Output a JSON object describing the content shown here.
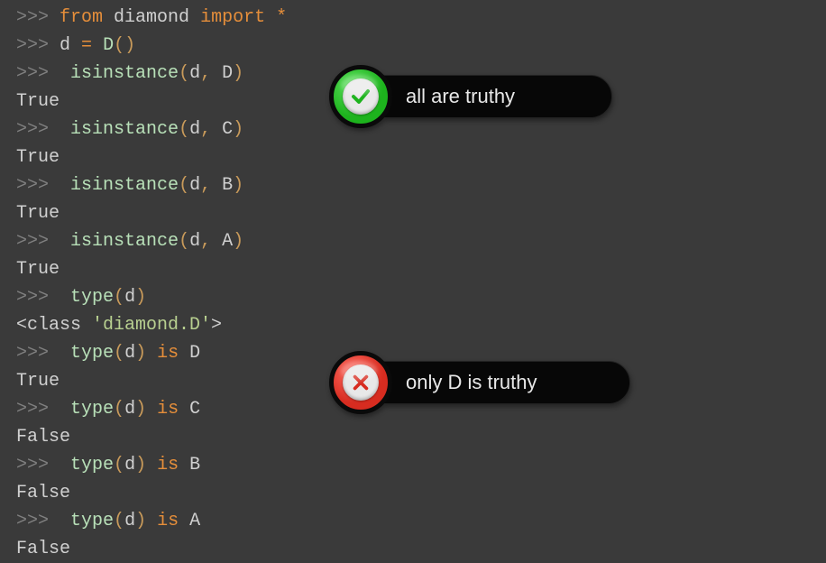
{
  "code_lines": [
    {
      "segments": [
        {
          "cls": "prompt",
          "t": ">>> "
        },
        {
          "cls": "kw",
          "t": "from"
        },
        {
          "cls": "txt",
          "t": " diamond "
        },
        {
          "cls": "kw",
          "t": "import"
        },
        {
          "cls": "txt",
          "t": " "
        },
        {
          "cls": "op",
          "t": "*"
        }
      ]
    },
    {
      "segments": [
        {
          "cls": "prompt",
          "t": ">>> "
        },
        {
          "cls": "txt",
          "t": "d "
        },
        {
          "cls": "op",
          "t": "="
        },
        {
          "cls": "txt",
          "t": " "
        },
        {
          "cls": "fn",
          "t": "D"
        },
        {
          "cls": "pn",
          "t": "()"
        }
      ]
    },
    {
      "segments": [
        {
          "cls": "prompt",
          "t": ">>> "
        },
        {
          "cls": "txt",
          "t": " "
        },
        {
          "cls": "fn",
          "t": "isinstance"
        },
        {
          "cls": "pn",
          "t": "("
        },
        {
          "cls": "txt",
          "t": "d"
        },
        {
          "cls": "cm",
          "t": ", "
        },
        {
          "cls": "txt",
          "t": "D"
        },
        {
          "cls": "pn",
          "t": ")"
        }
      ]
    },
    {
      "segments": [
        {
          "cls": "out",
          "t": "True"
        }
      ]
    },
    {
      "segments": [
        {
          "cls": "prompt",
          "t": ">>> "
        },
        {
          "cls": "txt",
          "t": " "
        },
        {
          "cls": "fn",
          "t": "isinstance"
        },
        {
          "cls": "pn",
          "t": "("
        },
        {
          "cls": "txt",
          "t": "d"
        },
        {
          "cls": "cm",
          "t": ", "
        },
        {
          "cls": "txt",
          "t": "C"
        },
        {
          "cls": "pn",
          "t": ")"
        }
      ]
    },
    {
      "segments": [
        {
          "cls": "out",
          "t": "True"
        }
      ]
    },
    {
      "segments": [
        {
          "cls": "prompt",
          "t": ">>> "
        },
        {
          "cls": "txt",
          "t": " "
        },
        {
          "cls": "fn",
          "t": "isinstance"
        },
        {
          "cls": "pn",
          "t": "("
        },
        {
          "cls": "txt",
          "t": "d"
        },
        {
          "cls": "cm",
          "t": ", "
        },
        {
          "cls": "txt",
          "t": "B"
        },
        {
          "cls": "pn",
          "t": ")"
        }
      ]
    },
    {
      "segments": [
        {
          "cls": "out",
          "t": "True"
        }
      ]
    },
    {
      "segments": [
        {
          "cls": "prompt",
          "t": ">>> "
        },
        {
          "cls": "txt",
          "t": " "
        },
        {
          "cls": "fn",
          "t": "isinstance"
        },
        {
          "cls": "pn",
          "t": "("
        },
        {
          "cls": "txt",
          "t": "d"
        },
        {
          "cls": "cm",
          "t": ", "
        },
        {
          "cls": "txt",
          "t": "A"
        },
        {
          "cls": "pn",
          "t": ")"
        }
      ]
    },
    {
      "segments": [
        {
          "cls": "out",
          "t": "True"
        }
      ]
    },
    {
      "segments": [
        {
          "cls": "prompt",
          "t": ">>> "
        },
        {
          "cls": "txt",
          "t": " "
        },
        {
          "cls": "fn",
          "t": "type"
        },
        {
          "cls": "pn",
          "t": "("
        },
        {
          "cls": "txt",
          "t": "d"
        },
        {
          "cls": "pn",
          "t": ")"
        }
      ]
    },
    {
      "segments": [
        {
          "cls": "out",
          "t": "<class "
        },
        {
          "cls": "str",
          "t": "'diamond.D'"
        },
        {
          "cls": "out",
          "t": ">"
        }
      ]
    },
    {
      "segments": [
        {
          "cls": "prompt",
          "t": ">>> "
        },
        {
          "cls": "txt",
          "t": " "
        },
        {
          "cls": "fn",
          "t": "type"
        },
        {
          "cls": "pn",
          "t": "("
        },
        {
          "cls": "txt",
          "t": "d"
        },
        {
          "cls": "pn",
          "t": ")"
        },
        {
          "cls": "txt",
          "t": " "
        },
        {
          "cls": "kw",
          "t": "is"
        },
        {
          "cls": "txt",
          "t": " D"
        }
      ]
    },
    {
      "segments": [
        {
          "cls": "out",
          "t": "True"
        }
      ]
    },
    {
      "segments": [
        {
          "cls": "prompt",
          "t": ">>> "
        },
        {
          "cls": "txt",
          "t": " "
        },
        {
          "cls": "fn",
          "t": "type"
        },
        {
          "cls": "pn",
          "t": "("
        },
        {
          "cls": "txt",
          "t": "d"
        },
        {
          "cls": "pn",
          "t": ")"
        },
        {
          "cls": "txt",
          "t": " "
        },
        {
          "cls": "kw",
          "t": "is"
        },
        {
          "cls": "txt",
          "t": " C"
        }
      ]
    },
    {
      "segments": [
        {
          "cls": "out",
          "t": "False"
        }
      ]
    },
    {
      "segments": [
        {
          "cls": "prompt",
          "t": ">>> "
        },
        {
          "cls": "txt",
          "t": " "
        },
        {
          "cls": "fn",
          "t": "type"
        },
        {
          "cls": "pn",
          "t": "("
        },
        {
          "cls": "txt",
          "t": "d"
        },
        {
          "cls": "pn",
          "t": ")"
        },
        {
          "cls": "txt",
          "t": " "
        },
        {
          "cls": "kw",
          "t": "is"
        },
        {
          "cls": "txt",
          "t": " B"
        }
      ]
    },
    {
      "segments": [
        {
          "cls": "out",
          "t": "False"
        }
      ]
    },
    {
      "segments": [
        {
          "cls": "prompt",
          "t": ">>> "
        },
        {
          "cls": "txt",
          "t": " "
        },
        {
          "cls": "fn",
          "t": "type"
        },
        {
          "cls": "pn",
          "t": "("
        },
        {
          "cls": "txt",
          "t": "d"
        },
        {
          "cls": "pn",
          "t": ")"
        },
        {
          "cls": "txt",
          "t": " "
        },
        {
          "cls": "kw",
          "t": "is"
        },
        {
          "cls": "txt",
          "t": " A"
        }
      ]
    },
    {
      "segments": [
        {
          "cls": "out",
          "t": "False"
        }
      ]
    }
  ],
  "badges": {
    "top": {
      "label": "all are truthy",
      "icon": "check-icon",
      "color": "green"
    },
    "bottom": {
      "label": "only D is truthy",
      "icon": "cross-icon",
      "color": "red"
    }
  }
}
